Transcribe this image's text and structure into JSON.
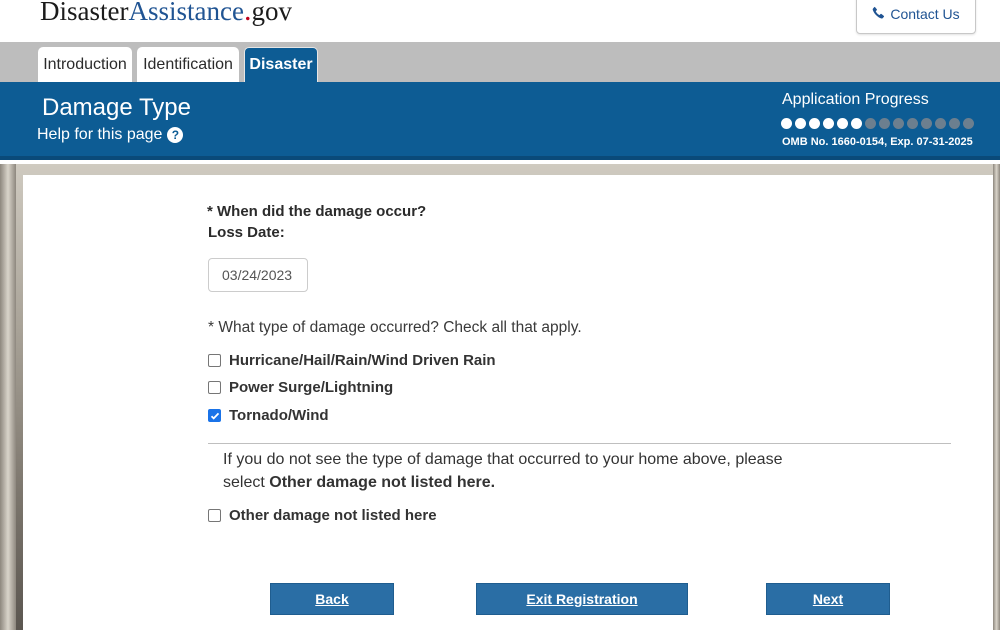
{
  "header": {
    "logo_part1": "Disaster",
    "logo_part2": "Assistance",
    "logo_dot": ".",
    "logo_part3": "gov",
    "contact_label": "Contact Us"
  },
  "tabs": [
    {
      "label": "Introduction"
    },
    {
      "label": "Identification"
    },
    {
      "label": "Disaster"
    }
  ],
  "band": {
    "page_title": "Damage Type",
    "help_label": "Help for this page",
    "help_icon_glyph": "?",
    "progress_title": "Application Progress",
    "progress_completed": 6,
    "progress_total": 14,
    "omb": "OMB No. 1660-0154, Exp. 07-31-2025"
  },
  "form": {
    "question1": "* When did the damage occur?",
    "loss_date_label": "Loss Date:",
    "loss_date_value": "03/24/2023",
    "question2": "* What type of damage occurred? Check all that apply.",
    "options": [
      {
        "label": "Hurricane/Hail/Rain/Wind Driven Rain",
        "checked": false
      },
      {
        "label": "Power Surge/Lightning",
        "checked": false
      },
      {
        "label": "Tornado/Wind",
        "checked": true
      }
    ],
    "note_line1": "If you do not see the type of damage that occurred to your home above, please",
    "note_line2_prefix": "select ",
    "note_line2_bold": "Other damage not listed here.",
    "other_option": {
      "label": "Other damage not listed here",
      "checked": false
    }
  },
  "buttons": {
    "back": "Back",
    "exit": "Exit Registration",
    "next": "Next"
  },
  "colors": {
    "accent": "#0d5c94",
    "button": "#2a6ea5",
    "checkbox_checked": "#1a73e8",
    "logo_dot": "#c0001a"
  },
  "icons": {
    "contact": "phone-icon",
    "help": "question-circle-icon",
    "checkmark": "checkmark-icon"
  }
}
